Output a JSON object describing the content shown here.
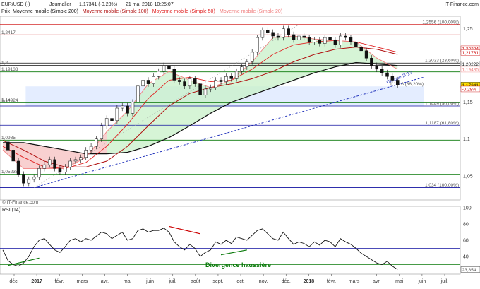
{
  "header": {
    "symbol": "EUR/USD (-)",
    "period": "Journalier",
    "quote": "1,17341 (-0,28%)",
    "datetime": "21 mai 2018 10:25:07",
    "brand": "IT-Finance.com"
  },
  "legend": {
    "prefix": "Prix",
    "items": [
      {
        "label": "Moyenne mobile (Simple 200)",
        "color": "#111111"
      },
      {
        "label": "Moyenne mobile (Simple 100)",
        "color": "#b01010"
      },
      {
        "label": "Moyenne mobile (Simple 50)",
        "color": "#e02020"
      },
      {
        "label": "Moyenne mobile (Simple 20)",
        "color": "#f08080"
      }
    ]
  },
  "copyright": "© IT-Finance.com",
  "colors": {
    "candle_up": "#ffffff",
    "candle_down": "#111111",
    "green_line": "#0a7a0a",
    "blue_line": "#1010a0",
    "red_line": "#cc0000",
    "trend_dash": "#2233bb",
    "fill_green": "#c8f0c8",
    "fill_red": "#f6c0c0",
    "box_fill": "#dde8ff"
  },
  "chart_data": [
    {
      "type": "line",
      "title": "EUR/USD",
      "ylim": [
        1.02,
        1.265
      ],
      "y_ticks": [
        "1,25",
        "1,2",
        "1,15",
        "1,1",
        "1,05"
      ],
      "x_labels": [
        "déc.",
        "2017",
        "févr.",
        "mars",
        "avr.",
        "mai",
        "juin",
        "juil.",
        "août",
        "sept.",
        "oct.",
        "nov.",
        "déc.",
        "2018",
        "févr.",
        "mars",
        "avr.",
        "mai",
        "juin",
        "juil."
      ],
      "price": {
        "x": [
          0,
          5,
          10,
          15,
          20,
          25,
          30,
          35,
          40,
          45,
          50,
          55,
          60,
          65,
          70,
          75,
          80,
          85,
          90,
          95,
          100,
          105,
          110,
          115,
          120,
          125,
          130,
          135,
          140,
          145,
          150,
          155,
          160,
          165,
          170,
          175,
          180,
          185,
          190,
          195,
          200,
          205,
          210,
          215,
          220,
          225,
          230,
          235,
          240,
          245,
          250,
          255,
          260,
          265,
          270,
          275,
          280,
          285,
          290,
          295,
          300,
          305,
          310,
          315,
          320,
          325,
          330,
          335,
          340,
          345,
          350,
          355,
          360,
          365,
          370,
          375,
          380
        ],
        "values": [
          1.096,
          1.085,
          1.07,
          1.052,
          1.04,
          1.045,
          1.048,
          1.06,
          1.065,
          1.072,
          1.06,
          1.055,
          1.062,
          1.07,
          1.072,
          1.075,
          1.085,
          1.09,
          1.1,
          1.118,
          1.128,
          1.125,
          1.142,
          1.145,
          1.135,
          1.15,
          1.172,
          1.18,
          1.175,
          1.185,
          1.192,
          1.2,
          1.195,
          1.18,
          1.178,
          1.172,
          1.182,
          1.175,
          1.16,
          1.168,
          1.17,
          1.18,
          1.178,
          1.185,
          1.182,
          1.192,
          1.198,
          1.205,
          1.218,
          1.238,
          1.248,
          1.245,
          1.24,
          1.238,
          1.25,
          1.242,
          1.235,
          1.24,
          1.238,
          1.232,
          1.235,
          1.23,
          1.238,
          1.235,
          1.228,
          1.24,
          1.238,
          1.232,
          1.225,
          1.22,
          1.21,
          1.2,
          1.195,
          1.19,
          1.185,
          1.18,
          1.173
        ]
      },
      "sma20": {
        "x": [
          0,
          20,
          40,
          60,
          80,
          100,
          120,
          140,
          160,
          180,
          200,
          220,
          240,
          260,
          280,
          300,
          320,
          340,
          360,
          380
        ],
        "values": [
          1.085,
          1.06,
          1.06,
          1.06,
          1.075,
          1.11,
          1.138,
          1.175,
          1.192,
          1.18,
          1.17,
          1.18,
          1.205,
          1.238,
          1.24,
          1.236,
          1.234,
          1.232,
          1.21,
          1.195
        ]
      },
      "sma50": {
        "x": [
          0,
          20,
          40,
          60,
          80,
          100,
          120,
          140,
          160,
          180,
          200,
          220,
          240,
          260,
          280,
          300,
          320,
          340,
          360,
          380
        ],
        "values": [
          1.09,
          1.075,
          1.062,
          1.06,
          1.068,
          1.09,
          1.12,
          1.155,
          1.18,
          1.184,
          1.178,
          1.18,
          1.195,
          1.215,
          1.228,
          1.232,
          1.234,
          1.232,
          1.225,
          1.218
        ]
      },
      "sma100": {
        "x": [
          0,
          20,
          40,
          60,
          80,
          100,
          120,
          140,
          160,
          180,
          200,
          220,
          240,
          260,
          280,
          300,
          320,
          340,
          360,
          380
        ],
        "values": [
          1.098,
          1.085,
          1.07,
          1.062,
          1.062,
          1.07,
          1.09,
          1.118,
          1.145,
          1.162,
          1.17,
          1.175,
          1.182,
          1.192,
          1.205,
          1.215,
          1.222,
          1.225,
          1.222,
          1.215
        ]
      },
      "sma200": {
        "x": [
          0,
          20,
          40,
          60,
          80,
          100,
          120,
          140,
          160,
          180,
          200,
          220,
          240,
          260,
          280,
          300,
          320,
          340,
          360,
          380
        ],
        "values": [
          1.095,
          1.095,
          1.09,
          1.085,
          1.08,
          1.08,
          1.082,
          1.09,
          1.102,
          1.118,
          1.135,
          1.15,
          1.16,
          1.17,
          1.18,
          1.19,
          1.198,
          1.204,
          1.202,
          1.2
        ]
      },
      "levels": [
        {
          "value": 1.2556,
          "label": "1,2556 (100,00%)",
          "color": "#cc0000"
        },
        {
          "value": 1.2417,
          "label": "1,2417",
          "color": "#cc0000"
        },
        {
          "value": 1.2033,
          "label": "1,2033 (23,60%)",
          "color": "#111111"
        },
        {
          "value": 1.2,
          "label": "1,2",
          "color": "#111111"
        },
        {
          "value": 1.19133,
          "label": "1,19133",
          "color": "#0a7a0a"
        },
        {
          "value": 1.15,
          "label": "1,15",
          "color": "#111111"
        },
        {
          "value": 1.14924,
          "label": "1,14924",
          "color": "#0a7a0a"
        },
        {
          "value": 1.1449,
          "label": "1,1449 (50,00%)",
          "color": "#1010a0"
        },
        {
          "value": 1.1187,
          "label": "1,1187 (61,80%)",
          "color": "#1010a0"
        },
        {
          "value": 1.0985,
          "label": "1,0985",
          "color": "#0a7a0a"
        },
        {
          "value": 1.0523,
          "label": "1,05238",
          "color": "#0a7a0a"
        },
        {
          "value": 1.034,
          "label": "1,034 (100,00%)",
          "color": "#1010a0"
        }
      ],
      "fib_box": {
        "from": 1.1449,
        "to": 1.1716,
        "label": "1,1716 (38,20%)"
      },
      "trendline": {
        "label": "Oblique 2017",
        "from": {
          "x": 30,
          "y": 1.034
        },
        "to": {
          "x": 405,
          "y": 1.184
        }
      },
      "right_labels": [
        {
          "value": 1.2228,
          "text": "1,22284",
          "bg": "#ffffff",
          "fg": "#cc0000"
        },
        {
          "value": 1.2176,
          "text": "1,21761",
          "bg": "#ffffff",
          "fg": "#cc0000"
        },
        {
          "value": 1.2022,
          "text": "1,20222",
          "bg": "#ffffff",
          "fg": "#111111"
        },
        {
          "value": 1.1949,
          "text": "1,19485",
          "bg": "#ffffff",
          "fg": "#f08080"
        },
        {
          "value": 1.1734,
          "text": "1,17341",
          "bg": "#ffe000",
          "fg": "#111111"
        },
        {
          "value": 1.168,
          "text": "-0,28%",
          "bg": "#ffffff",
          "fg": "#cc0000"
        }
      ]
    },
    {
      "type": "line",
      "title": "RSI (14)",
      "ylim": [
        20,
        100
      ],
      "y_ticks": [
        "100",
        "80",
        "60",
        "40"
      ],
      "last_value": "23,854",
      "levels": [
        70,
        50,
        30
      ],
      "annotation": "Divergence haussière",
      "x": [
        0,
        5,
        10,
        15,
        20,
        25,
        30,
        35,
        40,
        45,
        50,
        55,
        60,
        65,
        70,
        75,
        80,
        85,
        90,
        95,
        100,
        105,
        110,
        115,
        120,
        125,
        130,
        135,
        140,
        145,
        150,
        155,
        160,
        165,
        170,
        175,
        180,
        185,
        190,
        195,
        200,
        205,
        210,
        215,
        220,
        225,
        230,
        235,
        240,
        245,
        250,
        255,
        260,
        265,
        270,
        275,
        280,
        285,
        290,
        295,
        300,
        305,
        310,
        315,
        320,
        325,
        330,
        335,
        340,
        345,
        350,
        355,
        360,
        365,
        370,
        375,
        380
      ],
      "values": [
        48,
        35,
        30,
        28,
        32,
        40,
        52,
        60,
        62,
        55,
        48,
        45,
        52,
        60,
        62,
        58,
        62,
        60,
        65,
        70,
        68,
        62,
        66,
        70,
        60,
        62,
        72,
        74,
        70,
        72,
        72,
        75,
        70,
        58,
        52,
        48,
        55,
        50,
        40,
        45,
        48,
        58,
        55,
        60,
        56,
        64,
        62,
        60,
        66,
        72,
        74,
        68,
        62,
        60,
        70,
        62,
        55,
        58,
        56,
        52,
        58,
        54,
        60,
        58,
        52,
        62,
        58,
        55,
        50,
        44,
        40,
        36,
        32,
        30,
        34,
        28,
        24
      ]
    }
  ]
}
